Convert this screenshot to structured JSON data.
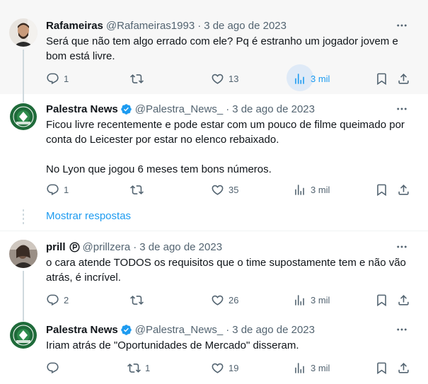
{
  "replies": [
    {
      "name": "Rafameiras",
      "handle": "@Rafameiras1993",
      "separator": "·",
      "date": "3 de ago de 2023",
      "text": "Será que não tem algo errado com ele? Pq é estranho um jogador jovem e bom está livre.",
      "stats": {
        "replies": "1",
        "retweets": "",
        "likes": "13",
        "views": "3 mil"
      }
    },
    {
      "name": "Palestra News",
      "handle": "@Palestra_News_",
      "separator": "·",
      "date": "3 de ago de 2023",
      "text": "Ficou livre recentemente e pode estar com um pouco de filme queimado por conta do Leicester por estar no elenco rebaixado.\n\nNo Lyon que jogou 6 meses tem bons números.",
      "stats": {
        "replies": "1",
        "retweets": "",
        "likes": "35",
        "views": "3 mil"
      }
    },
    {
      "name": "prill",
      "handle": "@prillzera",
      "separator": "·",
      "date": "3 de ago de 2023",
      "text": "o cara atende TODOS os requisitos que o time supostamente tem e não vão atrás, é incrível.",
      "stats": {
        "replies": "2",
        "retweets": "",
        "likes": "26",
        "views": "3 mil"
      }
    },
    {
      "name": "Palestra News",
      "handle": "@Palestra_News_",
      "separator": "·",
      "date": "3 de ago de 2023",
      "text": "Iriam atrás de \"Oportunidades de Mercado\" disseram.",
      "stats": {
        "replies": "",
        "retweets": "1",
        "likes": "19",
        "views": "3 mil"
      }
    }
  ],
  "show_replies_label": "Mostrar respostas",
  "icons": {
    "reply": "speech-bubble-icon",
    "retweet": "retweet-icon",
    "like": "heart-icon",
    "views": "bar-chart-icon",
    "bookmark": "bookmark-icon",
    "share": "share-upload-icon",
    "more": "more-horizontal-icon",
    "verified": "verified-badge-icon"
  },
  "colors": {
    "accent": "#1d9bf0",
    "muted": "#536471",
    "text": "#0f1419",
    "hover_bg": "#f7f7f7",
    "thread_line": "#cfd9de",
    "palestra_green": "#1f6b3a"
  }
}
